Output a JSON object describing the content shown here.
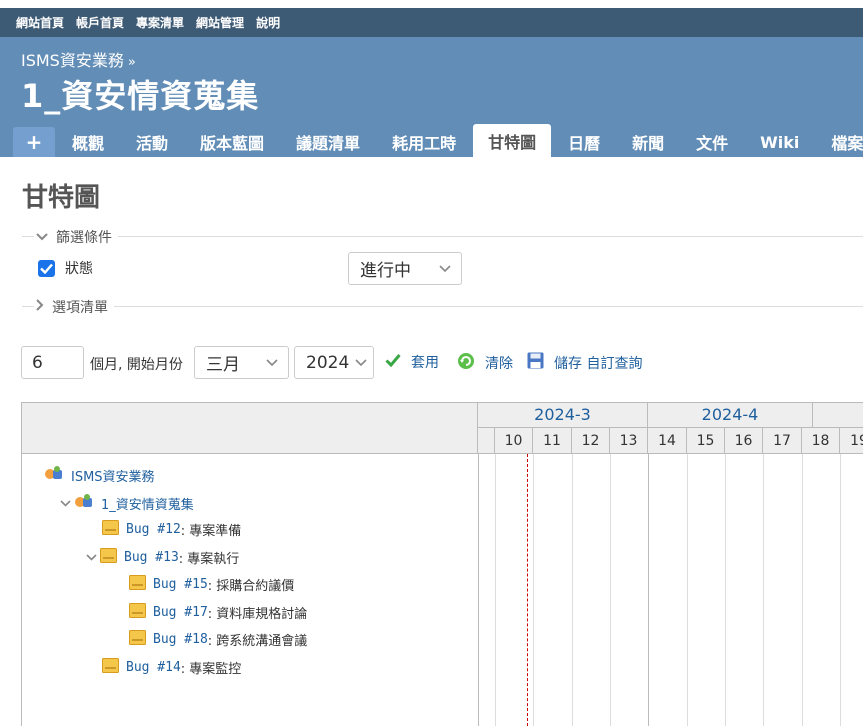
{
  "top_menu": [
    "網站首頁",
    "帳戶首頁",
    "專案清單",
    "網站管理",
    "說明"
  ],
  "header": {
    "parent_project": "ISMS資安業務",
    "breadcrumb_sep": "»",
    "project_title": "1_資安情資蒐集"
  },
  "tabs": [
    {
      "label": "+"
    },
    {
      "label": "概觀"
    },
    {
      "label": "活動"
    },
    {
      "label": "版本藍圖"
    },
    {
      "label": "議題清單"
    },
    {
      "label": "耗用工時"
    },
    {
      "label": "甘特圖",
      "selected": true
    },
    {
      "label": "日曆"
    },
    {
      "label": "新聞"
    },
    {
      "label": "文件"
    },
    {
      "label": "Wiki"
    },
    {
      "label": "檔案清"
    }
  ],
  "page_title": "甘特圖",
  "filters": {
    "legend": "篩選條件",
    "status_label": "狀態",
    "status_checked": true,
    "status_value": "進行中"
  },
  "options": {
    "legend": "選項清單"
  },
  "controls": {
    "months": "6",
    "months_label": "個月, 開始月份",
    "start_month": "三月",
    "start_year": "2024",
    "apply": "套用",
    "clear": "清除",
    "save": "儲存 自訂查詢"
  },
  "gantt": {
    "months": [
      "2024-3",
      "2024-4"
    ],
    "days": [
      "10",
      "11",
      "12",
      "13",
      "14",
      "15",
      "16",
      "17",
      "18",
      "19"
    ],
    "tree": [
      {
        "type": "project",
        "expand": "",
        "text": "ISMS資安業務"
      },
      {
        "type": "project",
        "expand": "⌄",
        "text": "1_資安情資蒐集"
      },
      {
        "type": "issue",
        "expand": "",
        "link": "Bug #12",
        "subject": ": 專案準備"
      },
      {
        "type": "issue",
        "expand": "⌄",
        "link": "Bug #13",
        "subject": ": 專案執行"
      },
      {
        "type": "issue",
        "expand": "",
        "link": "Bug #15",
        "subject": ": 採購合約議價"
      },
      {
        "type": "issue",
        "expand": "",
        "link": "Bug #17",
        "subject": ": 資料庫規格討論"
      },
      {
        "type": "issue",
        "expand": "",
        "link": "Bug #18",
        "subject": ": 跨系統溝通會議"
      },
      {
        "type": "issue",
        "expand": "",
        "link": "Bug #14",
        "subject": ": 專案監控"
      }
    ]
  },
  "colors": {
    "top_menu_bg": "#3e5b76",
    "header_bg": "#628db6",
    "link": "#1f5f9e"
  }
}
